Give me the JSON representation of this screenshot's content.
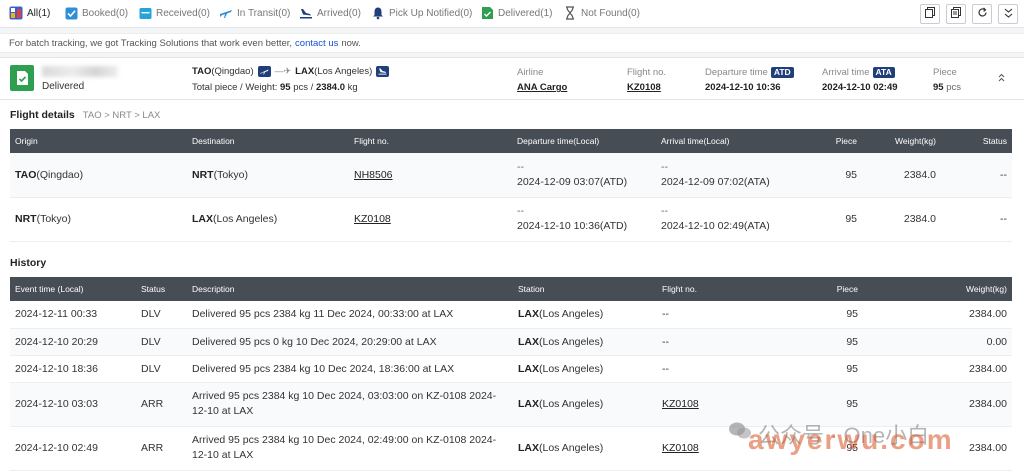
{
  "filters": [
    {
      "label": "All(1)",
      "icon": "all-shipments-icon",
      "active": true
    },
    {
      "label": "Booked(0)",
      "icon": "check-box-icon"
    },
    {
      "label": "Received(0)",
      "icon": "inbox-icon"
    },
    {
      "label": "In Transit(0)",
      "icon": "plane-icon"
    },
    {
      "label": "Arrived(0)",
      "icon": "landing-plane-icon"
    },
    {
      "label": "Pick Up Notified(0)",
      "icon": "bell-icon"
    },
    {
      "label": "Delivered(1)",
      "icon": "document-check-icon"
    },
    {
      "label": "Not Found(0)",
      "icon": "hourglass-icon"
    }
  ],
  "top_actions": [
    "copy-icon",
    "copy-all-icon",
    "refresh-icon",
    "collapse-all-icon"
  ],
  "notice": {
    "text": "For batch tracking, we got Tracking Solutions that work even better,",
    "link": "contact us",
    "suffix": "now."
  },
  "shipment": {
    "status": "Delivered",
    "origin_code": "TAO",
    "origin_city": "(Qingdao)",
    "dest_code": "LAX",
    "dest_city": "(Los Angeles)",
    "total_label": "Total piece / Weight:",
    "total_pieces": "95",
    "pcs_unit": "pcs",
    "weight_sep": "/",
    "total_weight": "2384.0",
    "kg_unit": "kg",
    "airline_label": "Airline",
    "airline": "ANA Cargo",
    "flight_label": "Flight no.",
    "flight": "KZ0108",
    "departure_label": "Departure time",
    "departure_tag": "ATD",
    "departure": "2024-12-10 10:36",
    "arrival_label": "Arrival time",
    "arrival_tag": "ATA",
    "arrival": "2024-12-10 02:49",
    "piece_label": "Piece",
    "pieces": "95"
  },
  "flight_details": {
    "title": "Flight details",
    "route": "TAO > NRT > LAX",
    "headers": [
      "Origin",
      "Destination",
      "Flight no.",
      "Departure time(Local)",
      "Arrival time(Local)",
      "Piece",
      "Weight(kg)",
      "Status"
    ],
    "rows": [
      {
        "origin_code": "TAO",
        "origin_city": "(Qingdao)",
        "dest_code": "NRT",
        "dest_city": "(Tokyo)",
        "flight": "NH8506",
        "dep_sched": "--",
        "dep_actual": "2024-12-09 03:07(ATD)",
        "arr_sched": "--",
        "arr_actual": "2024-12-09 07:02(ATA)",
        "piece": "95",
        "weight": "2384.0",
        "status": "--"
      },
      {
        "origin_code": "NRT",
        "origin_city": "(Tokyo)",
        "dest_code": "LAX",
        "dest_city": "(Los Angeles)",
        "flight": "KZ0108",
        "dep_sched": "--",
        "dep_actual": "2024-12-10 10:36(ATD)",
        "arr_sched": "--",
        "arr_actual": "2024-12-10 02:49(ATA)",
        "piece": "95",
        "weight": "2384.0",
        "status": "--"
      }
    ]
  },
  "history": {
    "title": "History",
    "headers": [
      "Event time (Local)",
      "Status",
      "Description",
      "Station",
      "Flight no.",
      "Piece",
      "Weight(kg)"
    ],
    "rows": [
      {
        "time": "2024-12-11 00:33",
        "status": "DLV",
        "desc": "Delivered 95 pcs 2384 kg 11 Dec 2024, 00:33:00 at LAX",
        "station_code": "LAX",
        "station_city": "(Los Angeles)",
        "flight": "--",
        "piece": "95",
        "weight": "2384.00"
      },
      {
        "time": "2024-12-10 20:29",
        "status": "DLV",
        "desc": "Delivered 95 pcs 0 kg 10 Dec 2024, 20:29:00 at LAX",
        "station_code": "LAX",
        "station_city": "(Los Angeles)",
        "flight": "--",
        "piece": "95",
        "weight": "0.00"
      },
      {
        "time": "2024-12-10 18:36",
        "status": "DLV",
        "desc": "Delivered 95 pcs 2384 kg 10 Dec 2024, 18:36:00 at LAX",
        "station_code": "LAX",
        "station_city": "(Los Angeles)",
        "flight": "--",
        "piece": "95",
        "weight": "2384.00"
      },
      {
        "time": "2024-12-10 03:03",
        "status": "ARR",
        "desc": "Arrived 95 pcs 2384 kg 10 Dec 2024, 03:03:00 on KZ-0108 2024-12-10 at LAX",
        "station_code": "LAX",
        "station_city": "(Los Angeles)",
        "flight": "KZ0108",
        "piece": "95",
        "weight": "2384.00"
      },
      {
        "time": "2024-12-10 02:49",
        "status": "ARR",
        "desc": "Arrived 95 pcs 2384 kg 10 Dec 2024, 02:49:00 on KZ-0108 2024-12-10 at LAX",
        "station_code": "LAX",
        "station_city": "(Los Angeles)",
        "flight": "KZ0108",
        "piece": "95",
        "weight": "2384.00"
      }
    ]
  },
  "watermark": {
    "text": "公众号 · One小白",
    "site": "awyerwu.com"
  },
  "colors": {
    "accent_navy": "#1f3e7a",
    "delivered_green": "#2e9e4f",
    "header_dark": "#474d55",
    "link_blue": "#1a4fd6"
  }
}
